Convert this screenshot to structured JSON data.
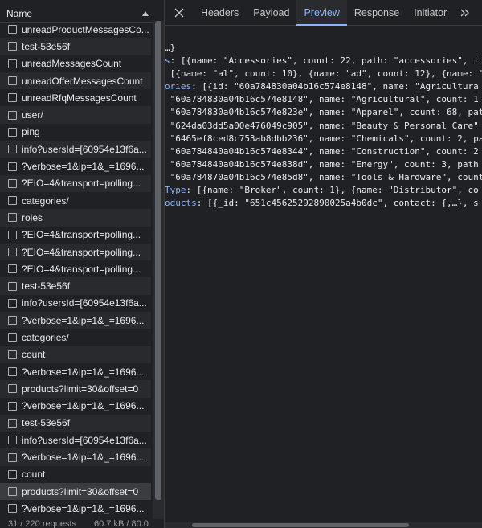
{
  "left_panel": {
    "header": "Name",
    "rows": [
      "unreadProductMessagesCo...",
      "test-53e56f",
      "unreadMessagesCount",
      "unreadOfferMessagesCount",
      "unreadRfqMessagesCount",
      "user/",
      "ping",
      "info?usersId=[60954e13f6a...",
      "?verbose=1&ip=1&_=1696...",
      "?EIO=4&transport=polling...",
      "categories/",
      "roles",
      "?EIO=4&transport=polling...",
      "?EIO=4&transport=polling...",
      "?EIO=4&transport=polling...",
      "test-53e56f",
      "info?usersId=[60954e13f6a...",
      "?verbose=1&ip=1&_=1696...",
      "categories/",
      "count",
      "?verbose=1&ip=1&_=1696...",
      "products?limit=30&offset=0",
      "?verbose=1&ip=1&_=1696...",
      "test-53e56f",
      "info?usersId=[60954e13f6a...",
      "?verbose=1&ip=1&_=1696...",
      "count",
      "products?limit=30&offset=0",
      "?verbose=1&ip=1&_=1696..."
    ],
    "selected_index": 27,
    "status": {
      "requests": "31 / 220 requests",
      "size": "60.7 kB / 80.0"
    }
  },
  "right_panel": {
    "tabs": [
      "Headers",
      "Payload",
      "Preview",
      "Response",
      "Initiator"
    ],
    "active_tab": "Preview",
    "more_label": "»",
    "lines": [
      {
        "key": "",
        "text": "…}"
      },
      {
        "key": "s",
        "text": ": [{name: \"Accessories\", count: 22, path: \"accessories\", i"
      },
      {
        "key": "",
        "text": " [{name: \"al\", count: 10}, {name: \"ad\", count: 12}, {name: \""
      },
      {
        "key": "ories",
        "text": ": [{id: \"60a784830a04b16c574e8148\", name: \"Agricultura"
      },
      {
        "key": "",
        "text": " \"60a784830a04b16c574e8148\", name: \"Agricultural\", count: 1"
      },
      {
        "key": "",
        "text": " \"60a784830a04b16c574e823e\", name: \"Apparel\", count: 68, pat"
      },
      {
        "key": "",
        "text": " \"624da03dd5a00e476049c905\", name: \"Beauty & Personal Care\""
      },
      {
        "key": "",
        "text": " \"6465ef8ced8c753ab8dbb236\", name: \"Chemicals\", count: 2, pa"
      },
      {
        "key": "",
        "text": " \"60a784840a04b16c574e8344\", name: \"Construction\", count: 2"
      },
      {
        "key": "",
        "text": " \"60a784840a04b16c574e838d\", name: \"Energy\", count: 3, path"
      },
      {
        "key": "",
        "text": " \"60a784870a04b16c574e85d8\", name: \"Tools & Hardware\", count"
      },
      {
        "key": "Type",
        "text": ": [{name: \"Broker\", count: 1}, {name: \"Distributor\", co"
      },
      {
        "key": "oducts",
        "text": ": [{_id: \"651c45625292890025a4b0dc\", contact: {,…}, s"
      }
    ]
  },
  "colors": {
    "accent": "#8ab4f8",
    "background": "#202124",
    "text": "#e8eaed"
  }
}
